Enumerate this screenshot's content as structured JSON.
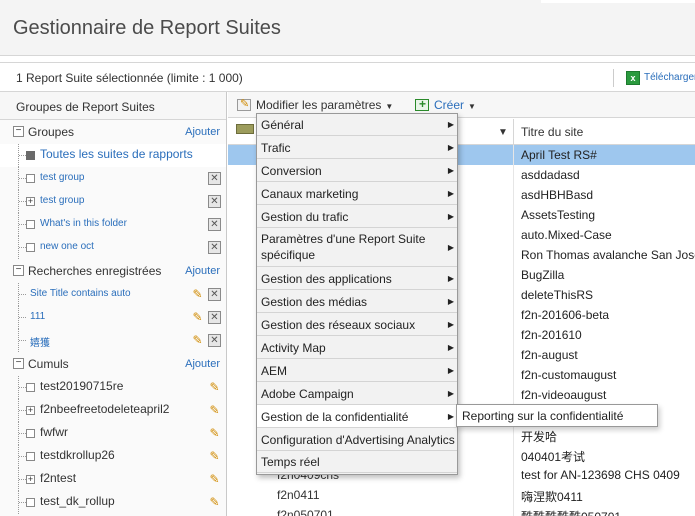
{
  "header": {
    "title": "Gestionnaire de Report Suites"
  },
  "selection_bar": {
    "text": "1 Report Suite sélectionnée (limite : 1 000)",
    "download_label": "Télécharger",
    "download_icon": "excel-icon"
  },
  "left_panel": {
    "title": "Groupes de Report Suites",
    "groups": {
      "title": "Groupes",
      "add_label": "Ajouter",
      "items": [
        "Toutes les suites de rapports",
        "test group",
        "test group",
        "What's in this folder",
        "new one oct"
      ]
    },
    "saved_searches": {
      "title": "Recherches enregistrées",
      "add_label": "Ajouter",
      "items": [
        "Site Title contains auto",
        "111",
        "嬉獲"
      ]
    },
    "rollups": {
      "title": "Cumuls",
      "add_label": "Ajouter",
      "items": [
        "test20190715re",
        "f2nbeefreetodeleteapril2",
        "fwfwr",
        "testdkrollup26",
        "f2ntest",
        "test_dk_rollup"
      ]
    }
  },
  "toolbar": {
    "edit_settings": "Modifier les paramètres",
    "create": "Créer"
  },
  "grid": {
    "title_column": "Titre du site",
    "rows": [
      {
        "id": "",
        "title": "April Test RS#",
        "selected": true
      },
      {
        "id": "",
        "title": "asddadasd"
      },
      {
        "id": "",
        "title": "asdHBHBasd"
      },
      {
        "id": "",
        "title": "AssetsTesting"
      },
      {
        "id": "",
        "title": "auto.Mixed-Case"
      },
      {
        "id": "",
        "title": "Ron Thomas avalanche San Jose"
      },
      {
        "id": "",
        "title": "BugZilla"
      },
      {
        "id": "",
        "title": "deleteThisRS"
      },
      {
        "id": "",
        "title": "f2n-201606-beta"
      },
      {
        "id": "",
        "title": "f2n-201610"
      },
      {
        "id": "",
        "title": "f2n-august"
      },
      {
        "id": "",
        "title": "f2n-customaugust"
      },
      {
        "id": "",
        "title": "f2n-videoaugust"
      },
      {
        "id": "",
        "title": ""
      },
      {
        "id": "",
        "title": "开发哈"
      },
      {
        "id": "",
        "title": "040401考试"
      },
      {
        "id": "f2n0409chs",
        "title": "test for AN-123698 CHS 0409"
      },
      {
        "id": "f2n0411",
        "title": "嗨涅欺0411"
      },
      {
        "id": "f2n050701",
        "title": "酷酷酷酷酷050701"
      }
    ]
  },
  "settings_menu": {
    "items": [
      {
        "label": "Général",
        "submenu": true
      },
      {
        "label": "Trafic",
        "submenu": true
      },
      {
        "label": "Conversion",
        "submenu": true
      },
      {
        "label": "Canaux marketing",
        "submenu": true
      },
      {
        "label": "Gestion du trafic",
        "submenu": true
      },
      {
        "label": "Paramètres d'une Report Suite spécifique",
        "submenu": true
      },
      {
        "label": "Gestion des applications",
        "submenu": true
      },
      {
        "label": "Gestion des médias",
        "submenu": true
      },
      {
        "label": "Gestion des réseaux sociaux",
        "submenu": true
      },
      {
        "label": "Activity Map",
        "submenu": true
      },
      {
        "label": "AEM",
        "submenu": true
      },
      {
        "label": "Adobe Campaign",
        "submenu": true
      },
      {
        "label": "Gestion de la confidentialité",
        "submenu": true
      },
      {
        "label": "Configuration d'Advertising Analytics",
        "submenu": false
      },
      {
        "label": "Temps réel",
        "submenu": false
      }
    ],
    "submenu_item": "Reporting sur la confidentialité"
  }
}
